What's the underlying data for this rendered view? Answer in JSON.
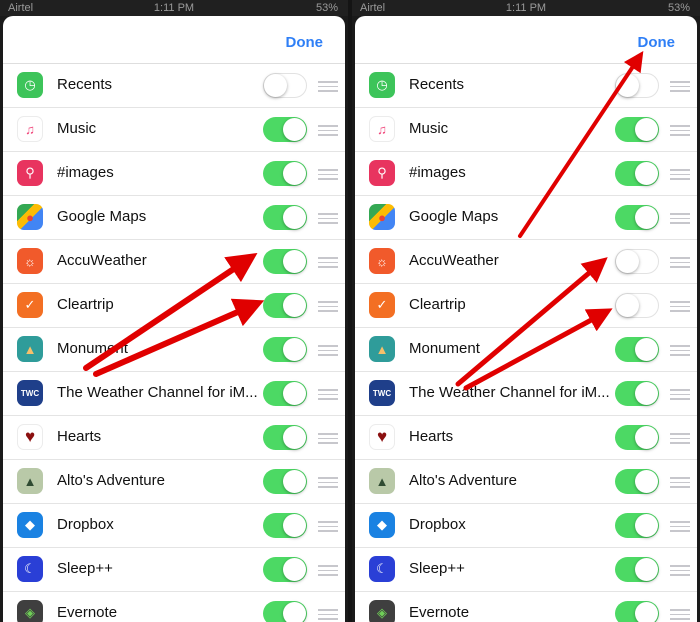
{
  "status_bar": {
    "carrier": "Airtel",
    "time": "1:11 PM",
    "battery": "53%"
  },
  "colors": {
    "toggle_on": "#4cd964",
    "done_blue": "#2f7ff6",
    "arrow_red": "#e00000"
  },
  "screens": [
    {
      "done_label": "Done",
      "apps": [
        {
          "label": "Recents",
          "icon": "clock-icon",
          "enabled": false
        },
        {
          "label": "Music",
          "icon": "music-note-icon",
          "enabled": true
        },
        {
          "label": "#images",
          "icon": "image-search-icon",
          "enabled": true
        },
        {
          "label": "Google Maps",
          "icon": "google-maps-icon",
          "enabled": true
        },
        {
          "label": "AccuWeather",
          "icon": "sun-icon",
          "enabled": true
        },
        {
          "label": "Cleartrip",
          "icon": "checkmark-icon",
          "enabled": true
        },
        {
          "label": "Monument",
          "icon": "monument-icon",
          "enabled": true
        },
        {
          "label": "The Weather Channel for iM...",
          "icon": "weather-channel-icon",
          "enabled": true
        },
        {
          "label": "Hearts",
          "icon": "heart-icon",
          "enabled": true
        },
        {
          "label": "Alto's Adventure",
          "icon": "tree-icon",
          "enabled": true
        },
        {
          "label": "Dropbox",
          "icon": "dropbox-icon",
          "enabled": true
        },
        {
          "label": "Sleep++",
          "icon": "moon-icon",
          "enabled": true
        },
        {
          "label": "Evernote",
          "icon": "elephant-icon",
          "enabled": true
        }
      ]
    },
    {
      "done_label": "Done",
      "apps": [
        {
          "label": "Recents",
          "icon": "clock-icon",
          "enabled": false
        },
        {
          "label": "Music",
          "icon": "music-note-icon",
          "enabled": true
        },
        {
          "label": "#images",
          "icon": "image-search-icon",
          "enabled": true
        },
        {
          "label": "Google Maps",
          "icon": "google-maps-icon",
          "enabled": true
        },
        {
          "label": "AccuWeather",
          "icon": "sun-icon",
          "enabled": false
        },
        {
          "label": "Cleartrip",
          "icon": "checkmark-icon",
          "enabled": false
        },
        {
          "label": "Monument",
          "icon": "monument-icon",
          "enabled": true
        },
        {
          "label": "The Weather Channel for iM...",
          "icon": "weather-channel-icon",
          "enabled": true
        },
        {
          "label": "Hearts",
          "icon": "heart-icon",
          "enabled": true
        },
        {
          "label": "Alto's Adventure",
          "icon": "tree-icon",
          "enabled": true
        },
        {
          "label": "Dropbox",
          "icon": "dropbox-icon",
          "enabled": true
        },
        {
          "label": "Sleep++",
          "icon": "moon-icon",
          "enabled": true
        },
        {
          "label": "Evernote",
          "icon": "elephant-icon",
          "enabled": true
        }
      ]
    }
  ]
}
